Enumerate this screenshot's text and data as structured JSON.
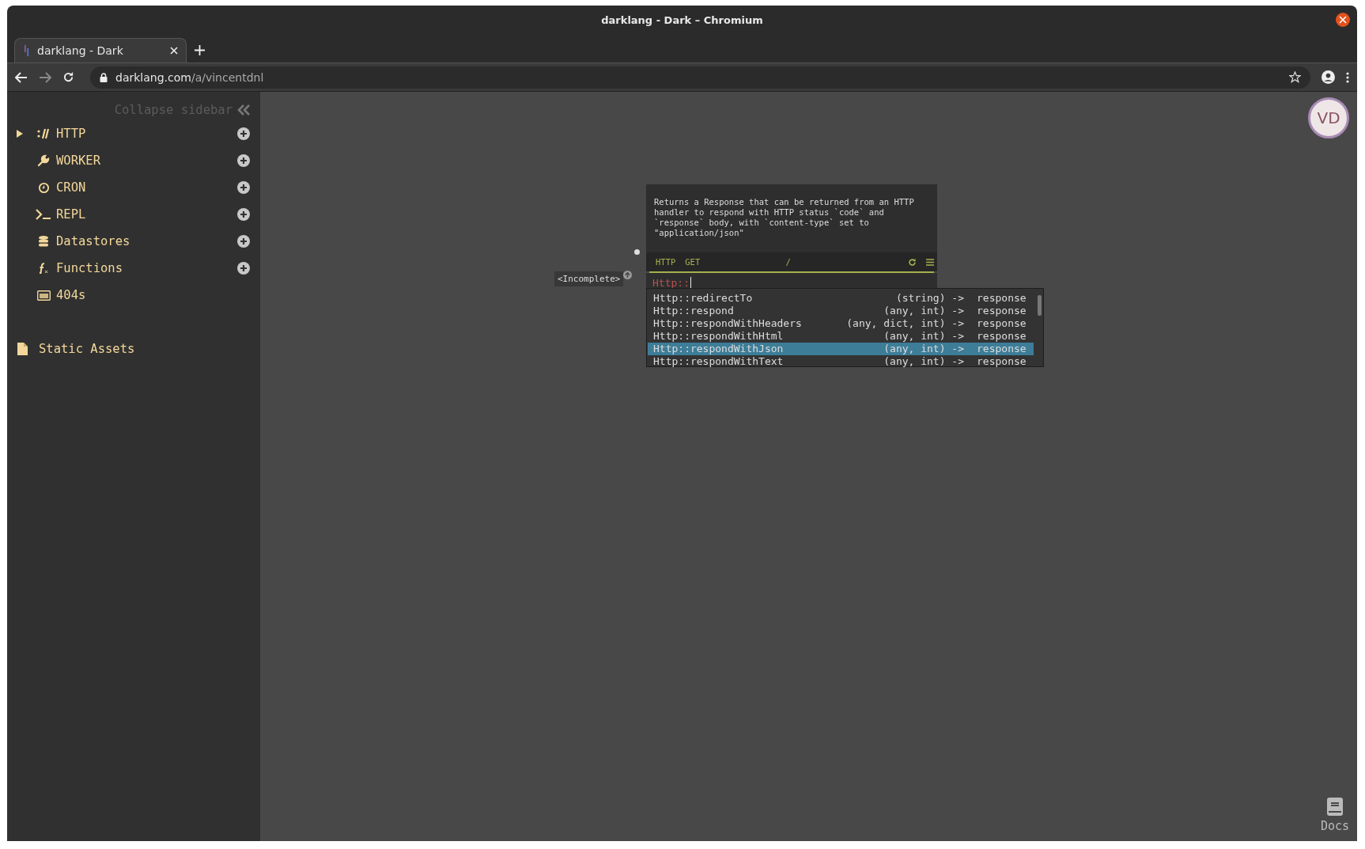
{
  "window": {
    "title": "darklang - Dark – Chromium"
  },
  "browser": {
    "tabs": [
      {
        "title": "darklang - Dark",
        "selected": true
      }
    ],
    "url_host": "darklang.com",
    "url_path": "/a/vincentdnl"
  },
  "sidebar": {
    "collapse_label": "Collapse sidebar",
    "categories": [
      {
        "kind": "http",
        "label": "HTTP",
        "expanded": false,
        "addable": true
      },
      {
        "kind": "worker",
        "label": "WORKER",
        "addable": true
      },
      {
        "kind": "cron",
        "label": "CRON",
        "addable": true
      },
      {
        "kind": "repl",
        "label": "REPL",
        "addable": true
      },
      {
        "kind": "datastores",
        "label": "Datastores",
        "addable": true
      },
      {
        "kind": "functions",
        "label": "Functions",
        "addable": true
      },
      {
        "kind": "notfound",
        "label": "404s",
        "addable": false
      }
    ],
    "static_assets": "Static Assets"
  },
  "canvas": {
    "avatar": "VD",
    "docs_label": "Docs",
    "incomplete_label": "<Incomplete>",
    "handler": {
      "description": "Returns a Response that can be returned from an HTTP handler to respond with HTTP status `code` and `response` body, with `content-type` set to \"application/json\"",
      "space": "HTTP",
      "method": "GET",
      "route": "/",
      "input": "Http::"
    },
    "autocomplete": [
      {
        "name": "Http::redirectTo",
        "signature": "(string) ->",
        "returns": "response",
        "selected": false
      },
      {
        "name": "Http::respond",
        "signature": "(any, int) ->",
        "returns": "response",
        "selected": false
      },
      {
        "name": "Http::respondWithHeaders",
        "signature": "(any, dict, int) ->",
        "returns": "response",
        "selected": false
      },
      {
        "name": "Http::respondWithHtml",
        "signature": "(any, int) ->",
        "returns": "response",
        "selected": false
      },
      {
        "name": "Http::respondWithJson",
        "signature": "(any, int) ->",
        "returns": "response",
        "selected": true
      },
      {
        "name": "Http::respondWithText",
        "signature": "(any, int) ->",
        "returns": "response",
        "selected": false
      }
    ]
  }
}
